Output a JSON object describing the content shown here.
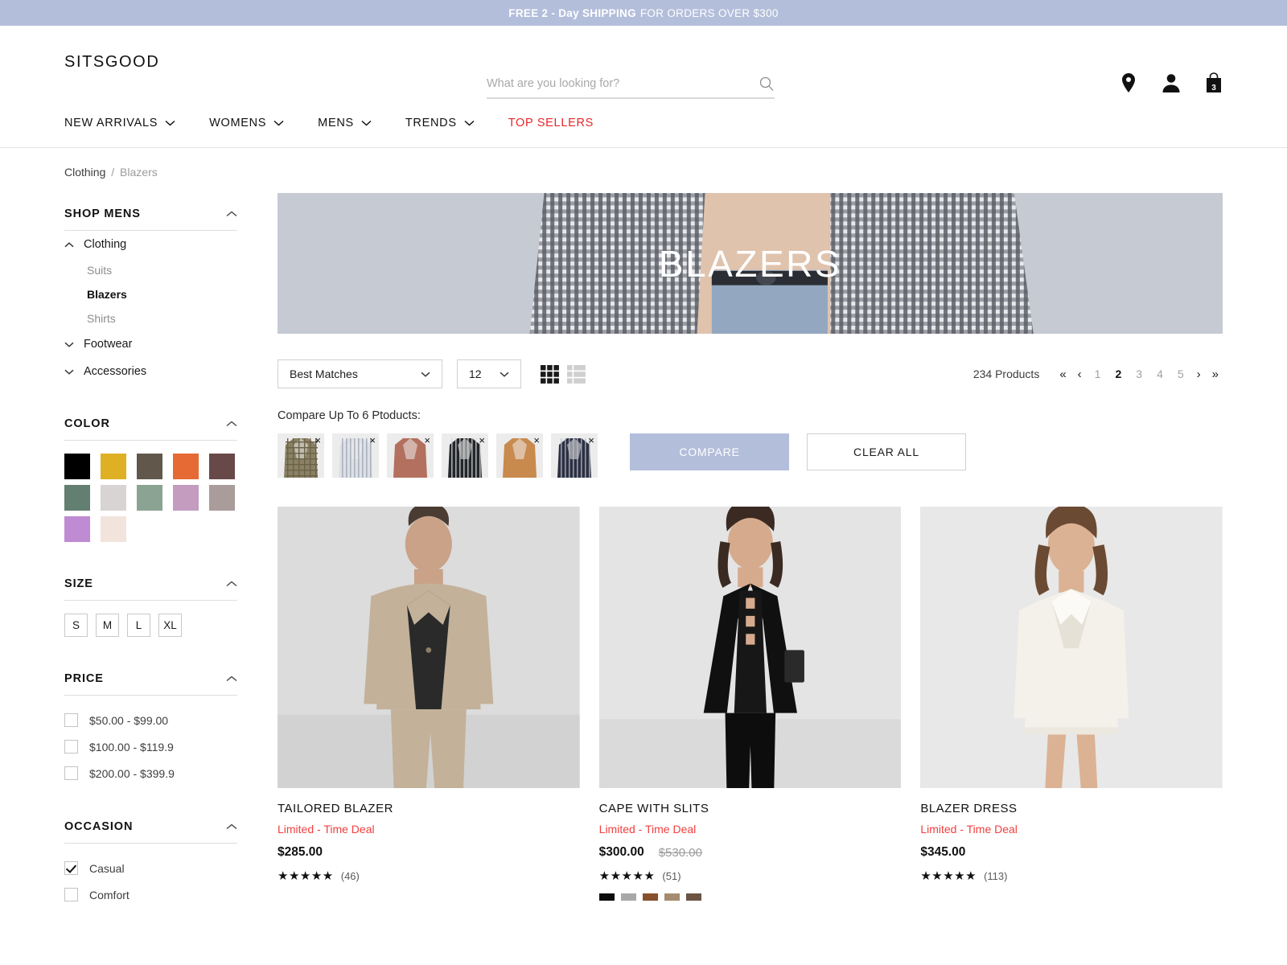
{
  "promo": {
    "strong": "FREE 2 - Day SHIPPING",
    "rest": "FOR ORDERS OVER $300",
    "bg": "#b3bedb"
  },
  "header": {
    "brand": "SITSGOOD",
    "search_placeholder": "What are you looking for?",
    "search_value": "",
    "cart_count": "3"
  },
  "nav": {
    "items": [
      {
        "label": "NEW ARRIVALS",
        "has_chevron": true,
        "accent": false
      },
      {
        "label": "WOMENS",
        "has_chevron": true,
        "accent": false
      },
      {
        "label": "MENS",
        "has_chevron": true,
        "accent": false
      },
      {
        "label": "TRENDS",
        "has_chevron": true,
        "accent": false
      },
      {
        "label": "TOP SELLERS",
        "has_chevron": false,
        "accent": true
      }
    ],
    "accent_color": "#e8252a"
  },
  "breadcrumb": {
    "parent": "Clothing",
    "separator": "/",
    "current": "Blazers"
  },
  "sidebar": {
    "shop": {
      "title": "SHOP MENS",
      "categories": [
        {
          "label": "Clothing",
          "expanded": true,
          "subitems": [
            {
              "label": "Suits",
              "active": false
            },
            {
              "label": "Blazers",
              "active": true
            },
            {
              "label": "Shirts",
              "active": false
            }
          ]
        },
        {
          "label": "Footwear",
          "expanded": false,
          "subitems": []
        },
        {
          "label": "Accessories",
          "expanded": false,
          "subitems": []
        }
      ]
    },
    "color": {
      "title": "COLOR",
      "swatches": [
        "#000000",
        "#dfb023",
        "#61574a",
        "#e56a33",
        "#67494a",
        "#627f72",
        "#d8d4d3",
        "#8ba393",
        "#c39cc0",
        "#a99c9a",
        "#bf8bd3",
        "#f2e4dc"
      ]
    },
    "size": {
      "title": "SIZE",
      "options": [
        "S",
        "M",
        "L",
        "XL"
      ]
    },
    "price": {
      "title": "PRICE",
      "options": [
        {
          "label": "$50.00 - $99.00",
          "checked": false
        },
        {
          "label": "$100.00 - $119.9",
          "checked": false
        },
        {
          "label": "$200.00 - $399.9",
          "checked": false
        }
      ]
    },
    "occasion": {
      "title": "OCCASION",
      "options": [
        {
          "label": "Casual",
          "checked": true
        },
        {
          "label": "Comfort",
          "checked": false
        }
      ]
    }
  },
  "hero": {
    "title": "BLAZERS"
  },
  "toolbar": {
    "sort_value": "Best Matches",
    "per_page_value": "12",
    "grid_view_active": true,
    "list_view_active": false,
    "product_count": "234 Products",
    "pagination": {
      "first": "«",
      "prev": "‹",
      "pages": [
        {
          "label": "1",
          "active": false
        },
        {
          "label": "2",
          "active": true
        },
        {
          "label": "3",
          "active": false
        },
        {
          "label": "4",
          "active": false
        },
        {
          "label": "5",
          "active": false
        }
      ],
      "next": "›",
      "last": "»"
    }
  },
  "compare": {
    "label": "Compare Up To 6 Ptoducts:",
    "remove_symbol": "×",
    "items": [
      {
        "name": "checked-olive-blazer",
        "base": "#8a8165",
        "accent": "#6b6247",
        "pattern": "check"
      },
      {
        "name": "white-pinstripe-blazer",
        "base": "#dde0e5",
        "accent": "#9aa3b0",
        "pattern": "stripe"
      },
      {
        "name": "rust-double-breasted-blazer",
        "base": "#b3705e",
        "accent": "#8f5546",
        "pattern": "plain"
      },
      {
        "name": "black-striped-blazer",
        "base": "#23262b",
        "accent": "#d8d8d8",
        "pattern": "stripe"
      },
      {
        "name": "camel-blazer",
        "base": "#c98a4e",
        "accent": "#b0743e",
        "pattern": "plain"
      },
      {
        "name": "navy-striped-blazer",
        "base": "#2c3042",
        "accent": "#b9bdc9",
        "pattern": "stripe"
      }
    ],
    "compare_button": "COMPARE",
    "clear_button": "CLEAR ALL",
    "compare_bg": "#b3bedb"
  },
  "products": [
    {
      "name": "TAILORED BLAZER",
      "deal": "Limited - Time Deal",
      "price": "$285.00",
      "price_was": "",
      "stars": "★★★★★",
      "reviews": "(46)",
      "img_bg": "#dcdcdc",
      "figure": "beige-suit",
      "colors": []
    },
    {
      "name": "CAPE WITH SLITS",
      "deal": "Limited - Time Deal",
      "price": "$300.00",
      "price_was": "$530.00",
      "stars": "★★★★★",
      "reviews": "(51)",
      "img_bg": "#e4e4e4",
      "figure": "black-cape",
      "colors": [
        "#0d0d0d",
        "#a8a8a8",
        "#87502c",
        "#a58b6f",
        "#6b5444"
      ]
    },
    {
      "name": "BLAZER DRESS",
      "deal": "Limited - Time Deal",
      "price": "$345.00",
      "price_was": "",
      "stars": "★★★★★",
      "reviews": "(113)",
      "img_bg": "#e8e8e8",
      "figure": "white-dress",
      "colors": []
    }
  ],
  "deal_color": "#f1403f"
}
